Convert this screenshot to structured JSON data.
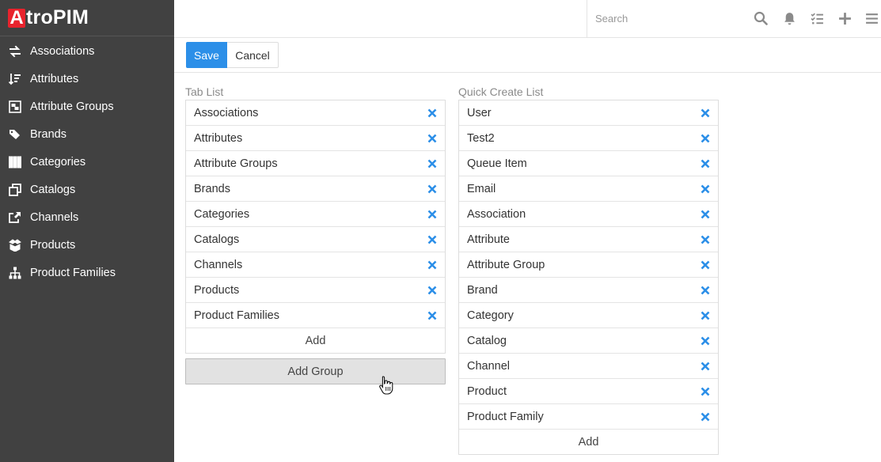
{
  "app": {
    "logo_letter": "A",
    "logo_rest": "troPIM"
  },
  "sidebar": {
    "items": [
      {
        "label": "Associations",
        "icon": "exchange-icon"
      },
      {
        "label": "Attributes",
        "icon": "sort-icon"
      },
      {
        "label": "Attribute Groups",
        "icon": "object-group-icon"
      },
      {
        "label": "Brands",
        "icon": "tags-icon"
      },
      {
        "label": "Categories",
        "icon": "table-icon"
      },
      {
        "label": "Catalogs",
        "icon": "clone-icon"
      },
      {
        "label": "Channels",
        "icon": "share-square-icon"
      },
      {
        "label": "Products",
        "icon": "box-open-icon"
      },
      {
        "label": "Product Families",
        "icon": "sitemap-icon"
      }
    ]
  },
  "topbar": {
    "search_placeholder": "Search",
    "icons": [
      "search-icon",
      "bell-icon",
      "tasks-icon",
      "plus-icon",
      "menu-icon"
    ]
  },
  "actions": {
    "save_label": "Save",
    "cancel_label": "Cancel"
  },
  "tab_list": {
    "label": "Tab List",
    "items": [
      "Associations",
      "Attributes",
      "Attribute Groups",
      "Brands",
      "Categories",
      "Catalogs",
      "Channels",
      "Products",
      "Product Families"
    ],
    "add_label": "Add",
    "add_group_label": "Add Group"
  },
  "quick_create_list": {
    "label": "Quick Create List",
    "items": [
      "User",
      "Test2",
      "Queue Item",
      "Email",
      "Association",
      "Attribute",
      "Attribute Group",
      "Brand",
      "Category",
      "Catalog",
      "Channel",
      "Product",
      "Product Family"
    ],
    "add_label": "Add"
  },
  "colors": {
    "sidebar_bg": "#414141",
    "accent": "#2c8fe8",
    "remove_icon": "#2c8fe8",
    "logo_red": "#e8232d"
  }
}
